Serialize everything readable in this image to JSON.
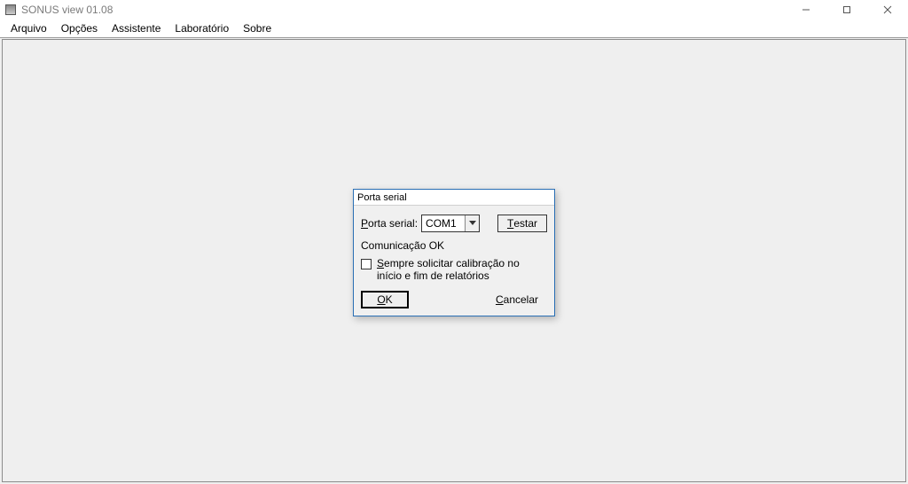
{
  "window": {
    "title": "SONUS view 01.08"
  },
  "menu": {
    "arquivo": "Arquivo",
    "opcoes": "Opções",
    "assistente": "Assistente",
    "laboratorio": "Laboratório",
    "sobre": "Sobre"
  },
  "dialog": {
    "title": "Porta serial",
    "port_label_pre": "P",
    "port_label_post": "orta serial:",
    "port_value": "COM1",
    "test_btn_pre": "T",
    "test_btn_post": "estar",
    "status": "Comunicação OK",
    "checkbox_pre": "S",
    "checkbox_post": "empre solicitar calibração no início e fim de relatórios",
    "ok_pre": "O",
    "ok_post": "K",
    "cancel_pre": "C",
    "cancel_post": "ancelar"
  }
}
